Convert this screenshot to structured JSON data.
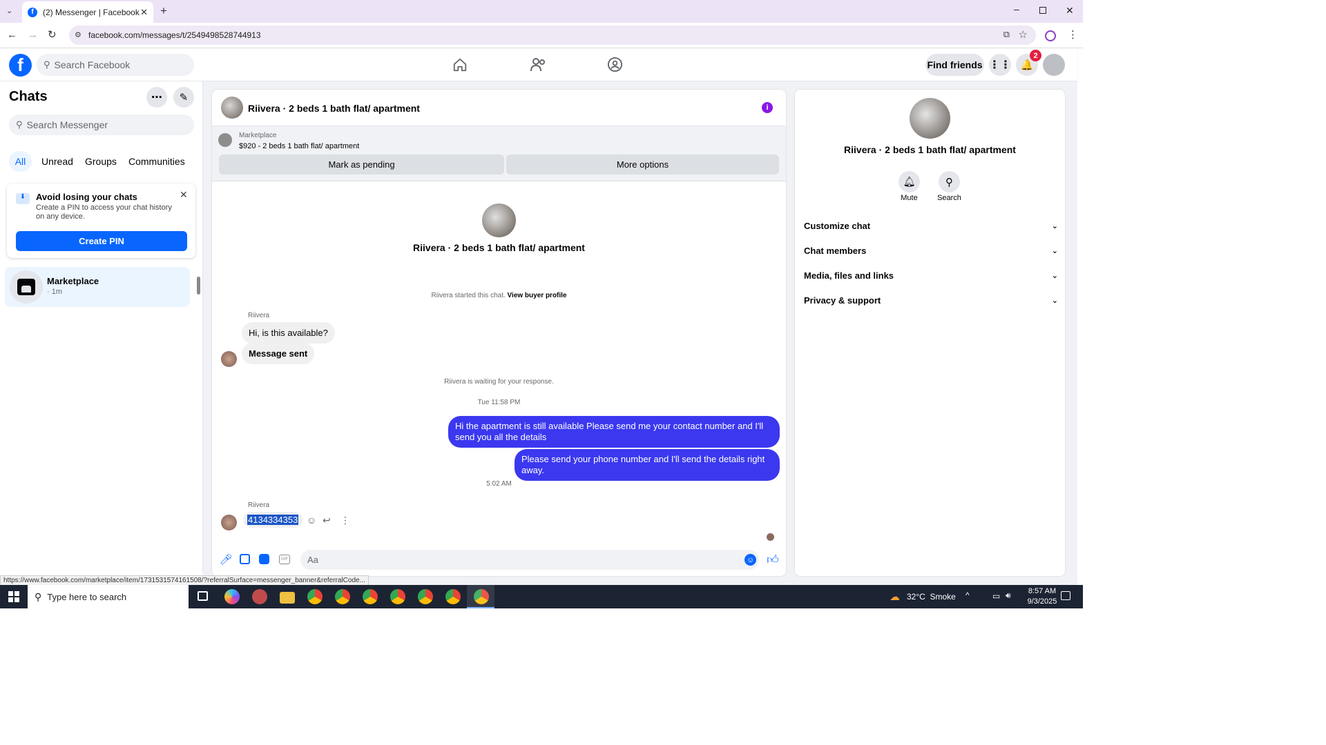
{
  "browser": {
    "tab_title": "(2) Messenger | Facebook",
    "url": "facebook.com/messages/t/2549498528744913",
    "status_url": "https://www.facebook.com/marketplace/item/1731531574161508/?referralSurface=messenger_banner&referralCode..."
  },
  "fb_nav": {
    "search_placeholder": "Search Facebook",
    "find_friends": "Find friends",
    "notification_count": "2"
  },
  "sidebar": {
    "title": "Chats",
    "search_placeholder": "Search Messenger",
    "filters": [
      "All",
      "Unread",
      "Groups",
      "Communities"
    ],
    "pin_card": {
      "title": "Avoid losing your chats",
      "body": "Create a PIN to access your chat history on any device.",
      "button": "Create PIN"
    },
    "chats": [
      {
        "name": "Marketplace",
        "time": "· 1m"
      }
    ]
  },
  "conversation": {
    "title": "Riivera · 2 beds 1 bath flat/ apartment",
    "banner_source": "Marketplace",
    "banner_listing": "$920 - 2 beds 1 bath flat/ apartment",
    "mark_pending": "Mark as pending",
    "more_options": "More options",
    "intro_name": "Riivera · 2 beds 1 bath flat/ apartment",
    "started_text": "Riivera started this chat.",
    "view_buyer": "View buyer profile",
    "sender_label_1": "Riivera",
    "msg_in_1": "Hi, is this available?",
    "msg_in_2": "Message sent",
    "waiting_text": "Riivera is waiting for your response.",
    "time_1": "Tue 11:58 PM",
    "msg_out_1": "Hi the apartment is still available Please send me your contact number and I'll send you all the details",
    "msg_out_2": "Please send your phone number and I'll send the details right away.",
    "time_2": "5:02 AM",
    "sender_label_2": "Riivera",
    "msg_in_3": "4134334353",
    "composer_placeholder": "Aa"
  },
  "details": {
    "name": "Riivera · 2 beds 1 bath flat/ apartment",
    "mute": "Mute",
    "search": "Search",
    "sections": [
      "Customize chat",
      "Chat members",
      "Media, files and links",
      "Privacy & support"
    ]
  },
  "taskbar": {
    "search_placeholder": "Type here to search",
    "weather": "32°C  Smoke",
    "time": "8:57 AM",
    "date": "9/3/2025"
  },
  "colors": {
    "fb_blue": "#0866ff",
    "outgoing": "#3b38f0",
    "info_purple": "#8a16e6",
    "badge_red": "#e41e3f"
  }
}
